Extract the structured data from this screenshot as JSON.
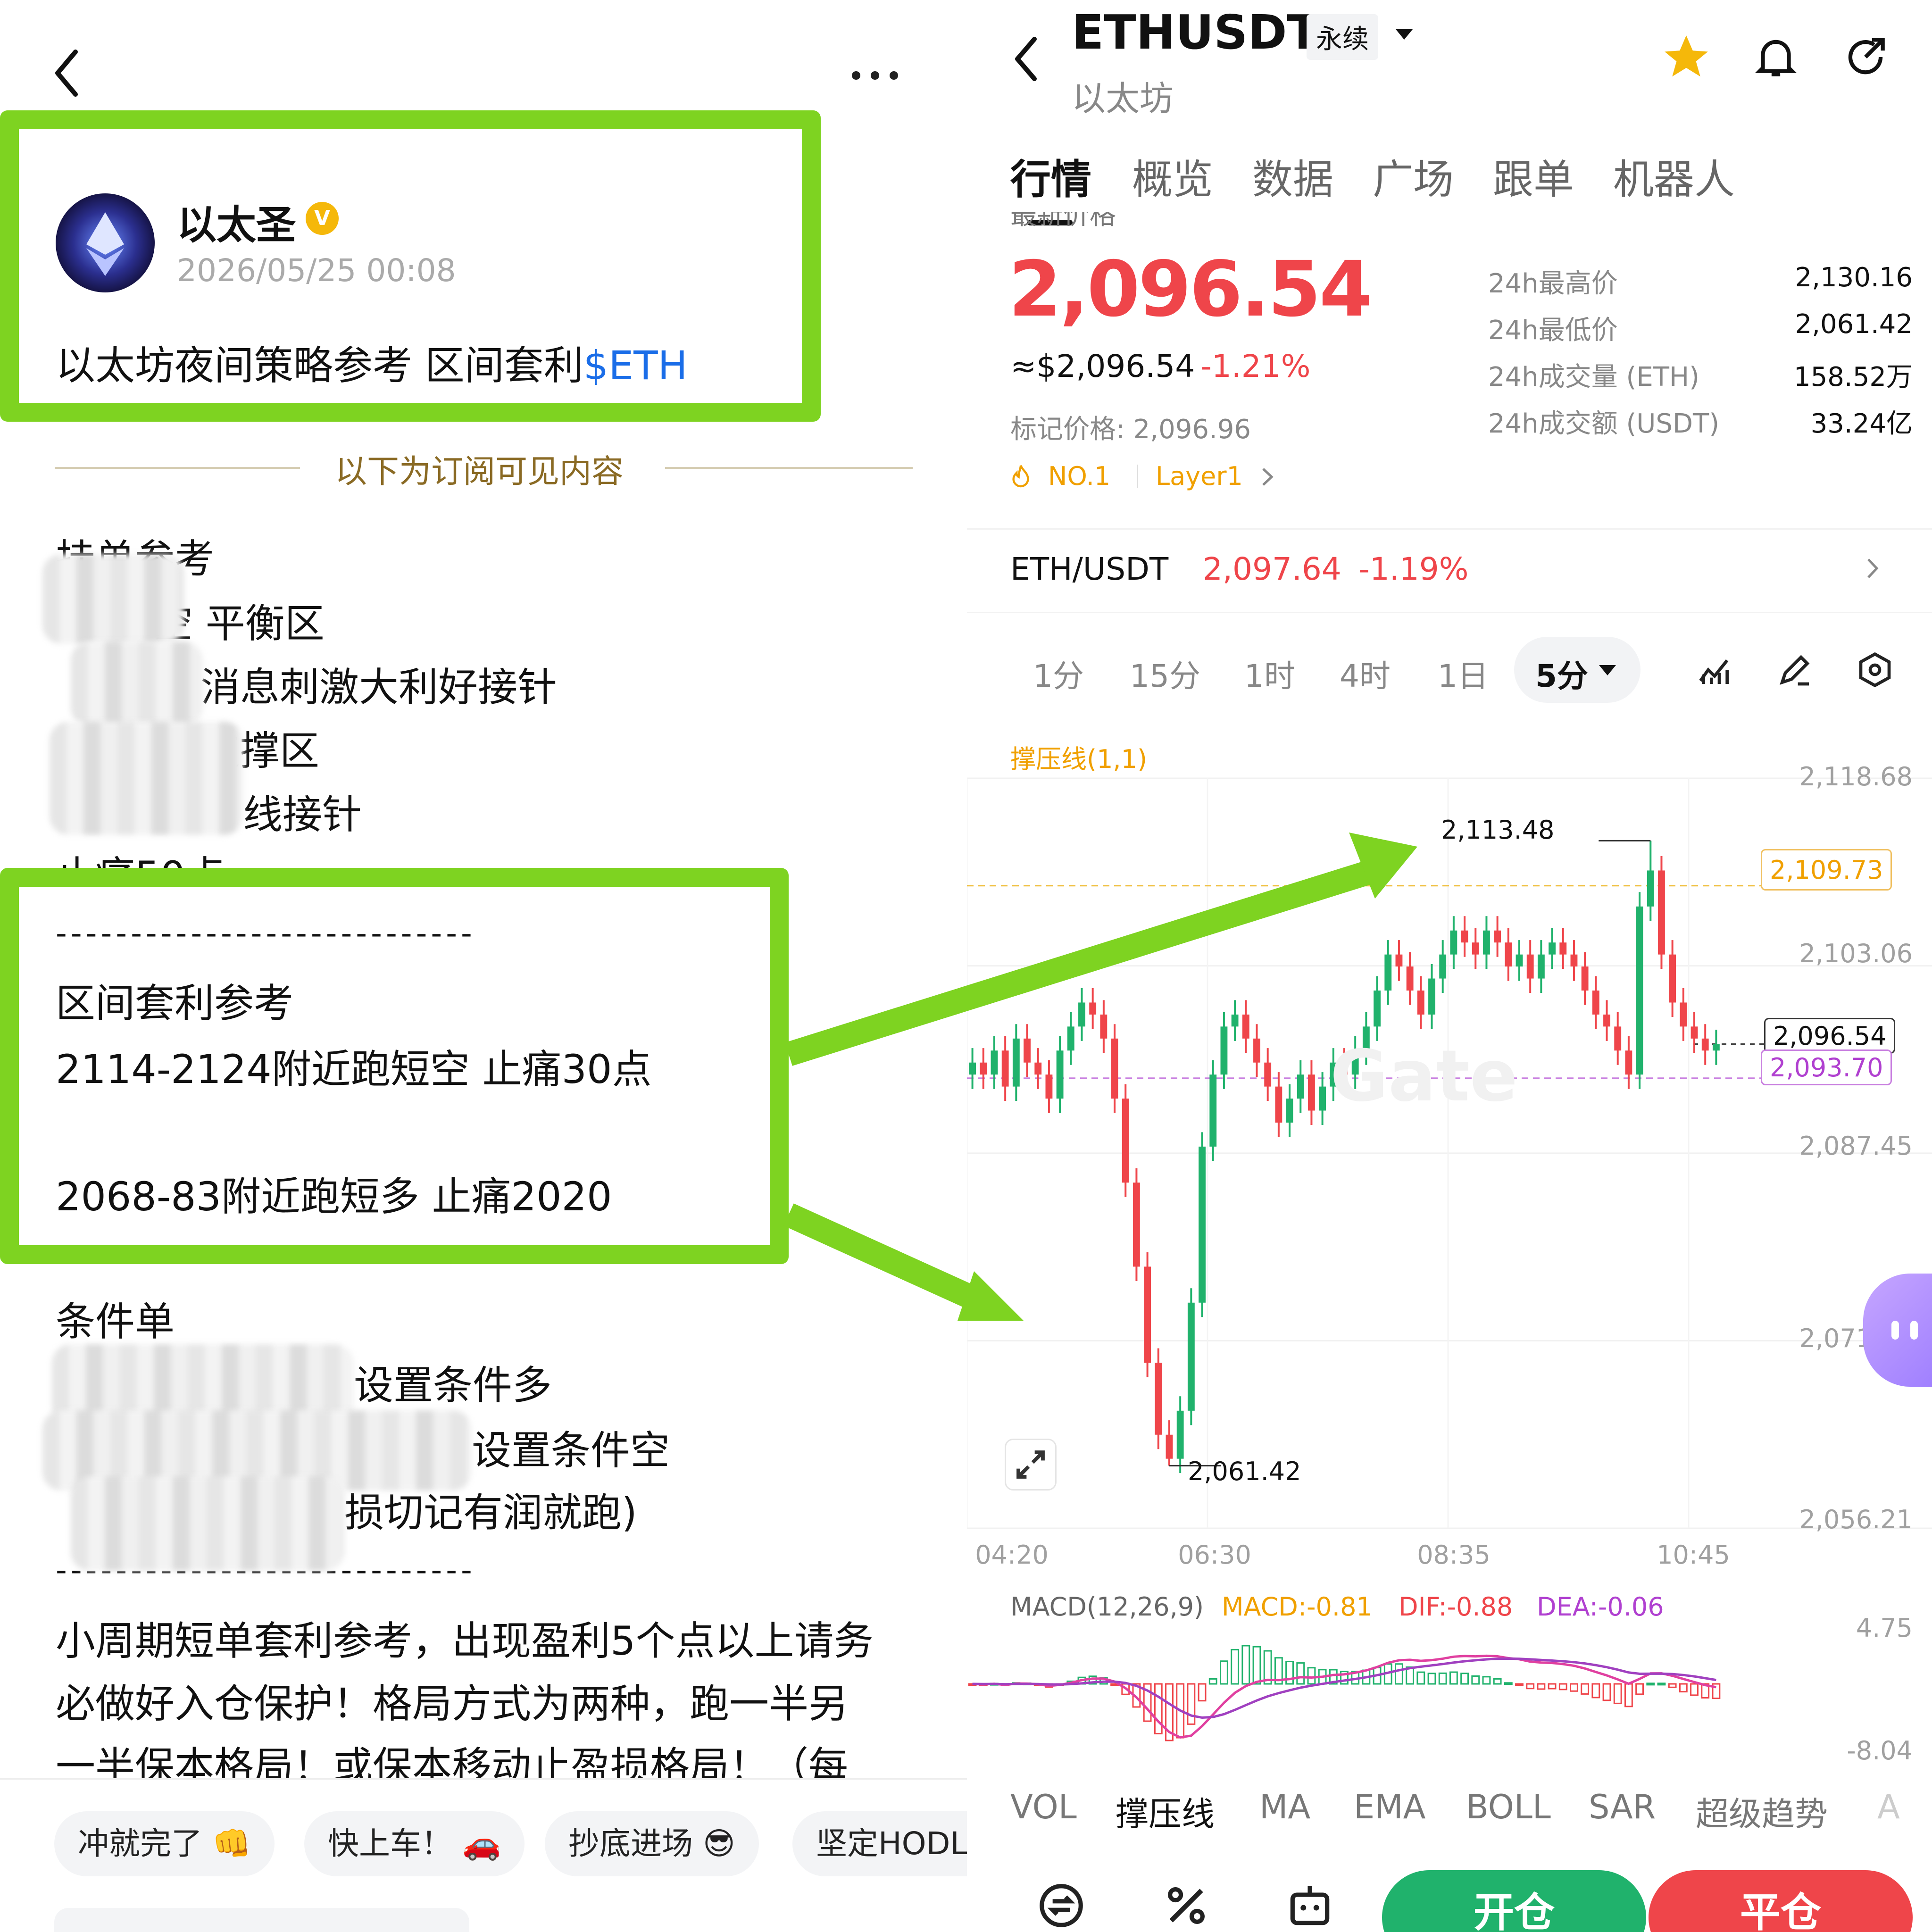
{
  "post": {
    "author": "以太圣",
    "verified_badge": "V",
    "timestamp": "2026/05/25 00:08",
    "title": "以太坊夜间策略参考 区间套利",
    "ticker_link": "$ETH",
    "subscription_divider": "以下为订阅可见内容",
    "lines_a": [
      "挂单参考",
      "空 平衡区",
      "消息刺激大利好接针",
      "支撑区",
      "线接针",
      "止痛50点"
    ],
    "separator": "----------------------------",
    "range_title": "区间套利参考",
    "range_short": "2114-2124附近跑短空 止痛30点",
    "range_long": "2068-83附近跑短多 止痛2020",
    "lines_b": [
      "条件单",
      "设置条件多",
      "设置条件空",
      "损切记有润就跑)"
    ],
    "footer_para": [
      "小周期短单套利参考，出现盈利5个点以上请务",
      "必做好入仓保护！格局方式为两种，跑一半另",
      "一半保本格局！或保本移动止盈损格局！（每"
    ],
    "chips": [
      "冲就完了 👊",
      "快上车！ 🚗",
      "抄底进场 😎",
      "坚定HODL"
    ]
  },
  "market": {
    "symbol": "ETHUSDT",
    "contract_type": "永续",
    "name": "以太坊",
    "tabs": [
      "行情",
      "概览",
      "数据",
      "广场",
      "跟单",
      "机器人"
    ],
    "last_price_label": "最新价格",
    "last_price": "2,096.54",
    "usd_price": "≈$2,096.54",
    "change_pct": "-1.21%",
    "mark_price": "标记价格: 2,096.96",
    "rank_tag": "NO.1",
    "category_tag": "Layer1",
    "stats": [
      {
        "label": "24h最高价",
        "value": "2,130.16"
      },
      {
        "label": "24h最低价",
        "value": "2,061.42"
      },
      {
        "label": "24h成交量 (ETH)",
        "value": "158.52万"
      },
      {
        "label": "24h成交额 (USDT)",
        "value": "33.24亿"
      }
    ],
    "spot_pair": "ETH/USDT",
    "spot_price": "2,097.64",
    "spot_change": "-1.19%",
    "intervals": [
      "1分",
      "15分",
      "1时",
      "4时",
      "1日"
    ],
    "active_interval": "5分",
    "indicator_label": "撑压线(1,1)",
    "y_ticks": [
      "2,118.68",
      "2,103.06",
      "2,087.45",
      "2,071.83",
      "2,056.21"
    ],
    "resistance_tag": "2,109.73",
    "current_tag": "2,096.54",
    "support_tag": "2,093.70",
    "high_marker": "2,113.48",
    "low_marker": "2,061.42",
    "x_ticks": [
      "04:20",
      "06:30",
      "08:35",
      "10:45"
    ],
    "watermark": "Gate",
    "macd": {
      "label": "MACD(12,26,9)",
      "macd": "MACD:-0.81",
      "dif": "DIF:-0.88",
      "dea": "DEA:-0.06",
      "top": "4.75",
      "bottom": "-8.04"
    },
    "indicator_tabs": [
      "VOL",
      "撑压线",
      "MA",
      "EMA",
      "BOLL",
      "SAR",
      "超级趋势",
      "A"
    ],
    "open_btn": "开仓",
    "close_btn": "平仓",
    "colors": {
      "up": "#20b26c",
      "down": "#ef454a",
      "highlight": "#7ed321",
      "accent": "#f0a000",
      "support": "#b040d0"
    }
  },
  "chart_data": {
    "type": "candlestick",
    "title": "ETHUSDT 5分",
    "x_ticks": [
      "04:20",
      "06:30",
      "08:35",
      "10:45"
    ],
    "ylim": [
      2056.21,
      2118.68
    ],
    "y_ticks": [
      2118.68,
      2103.06,
      2087.45,
      2071.83,
      2056.21
    ],
    "annotations": {
      "high": 2113.48,
      "low": 2061.42,
      "resistance": 2109.73,
      "current": 2096.54,
      "support": 2093.7
    },
    "close_series": [
      2095,
      2094,
      2096,
      2093,
      2097,
      2095,
      2094,
      2092,
      2096,
      2098,
      2100,
      2099,
      2097,
      2092,
      2085,
      2078,
      2070,
      2064,
      2062,
      2066,
      2075,
      2088,
      2094,
      2098,
      2099,
      2097,
      2095,
      2093,
      2090,
      2092,
      2094,
      2091,
      2093,
      2095,
      2094,
      2096,
      2098,
      2101,
      2104,
      2103,
      2101,
      2099,
      2102,
      2104,
      2106,
      2105,
      2104,
      2106,
      2105,
      2103,
      2104,
      2102,
      2104,
      2105,
      2104,
      2103,
      2101,
      2099,
      2098,
      2096,
      2094,
      2108,
      2111,
      2104,
      2100,
      2098,
      2097,
      2096,
      2096.54
    ],
    "macd": {
      "top": 4.75,
      "bottom": -8.04,
      "macd": -0.81,
      "dif": -0.88,
      "dea": -0.06
    }
  }
}
